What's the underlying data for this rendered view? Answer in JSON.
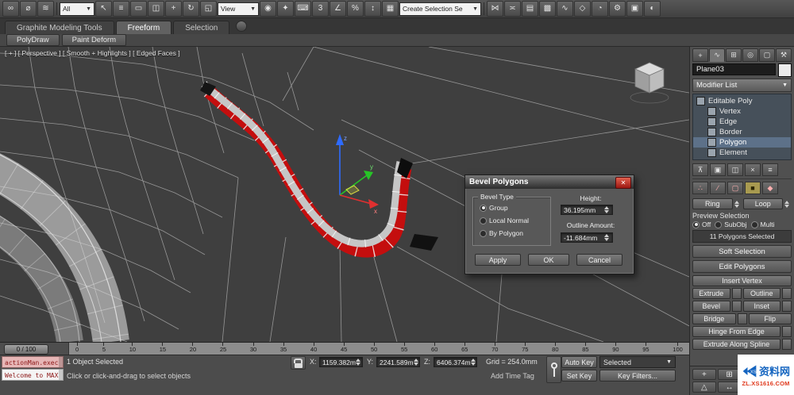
{
  "watermark": {
    "site": "资料网",
    "url": "ZL.XS1616.COM"
  },
  "toolbar": {
    "filter_value": "All",
    "coord_value": "View",
    "selection_set_value": "Create Selection Se",
    "group1": [
      {
        "name": "select-and-link-icon",
        "glyph": "∞"
      },
      {
        "name": "unlink-selection-icon",
        "glyph": "⌀"
      },
      {
        "name": "bind-to-space-warp-icon",
        "glyph": "≋"
      }
    ],
    "group2": [
      {
        "name": "select-object-icon",
        "glyph": "↖"
      },
      {
        "name": "select-by-name-icon",
        "glyph": "≡"
      },
      {
        "name": "rectangular-selection-region-icon",
        "glyph": "▭"
      },
      {
        "name": "window-crossing-icon",
        "glyph": "◫"
      },
      {
        "name": "select-and-move-icon",
        "glyph": "+"
      },
      {
        "name": "select-and-rotate-icon",
        "glyph": "↻"
      },
      {
        "name": "select-and-scale-icon",
        "glyph": "◱"
      }
    ],
    "group3": [
      {
        "name": "use-pivot-point-center-icon",
        "glyph": "◉"
      },
      {
        "name": "select-and-manipulate-icon",
        "glyph": "✦"
      },
      {
        "name": "keyboard-shortcut-override-icon",
        "glyph": "⌨"
      },
      {
        "name": "snaps-toggle-icon",
        "glyph": "3"
      },
      {
        "name": "angle-snap-icon",
        "glyph": "∠"
      },
      {
        "name": "percent-snap-icon",
        "glyph": "%"
      },
      {
        "name": "spinner-snap-icon",
        "glyph": "↕"
      },
      {
        "name": "named-selection-sets-icon",
        "glyph": "▦"
      }
    ],
    "group4": [
      {
        "name": "mirror-icon",
        "glyph": "⋈"
      },
      {
        "name": "align-icon",
        "glyph": "≍"
      },
      {
        "name": "layer-manager-icon",
        "glyph": "▤"
      },
      {
        "name": "graphite-ribbon-icon",
        "glyph": "▩"
      },
      {
        "name": "curve-editor-icon",
        "glyph": "∿"
      },
      {
        "name": "schematic-view-icon",
        "glyph": "◇"
      },
      {
        "name": "material-editor-icon",
        "glyph": "◔"
      },
      {
        "name": "render-setup-icon",
        "glyph": "⚙"
      },
      {
        "name": "rendered-frame-icon",
        "glyph": "▣"
      },
      {
        "name": "render-production-icon",
        "glyph": "◐"
      }
    ]
  },
  "ribbon": {
    "tabs": [
      {
        "label": "Graphite Modeling Tools"
      },
      {
        "label": "Freeform",
        "active": true
      },
      {
        "label": "Selection"
      }
    ],
    "subtabs": [
      {
        "label": "PolyDraw"
      },
      {
        "label": "Paint Deform"
      }
    ]
  },
  "viewport": {
    "label": "[ + ]  [ Perspective ]  [ Smooth + Highlights ]  [ Edged Faces ]"
  },
  "dialog": {
    "title": "Bevel Polygons",
    "group_label": "Bevel Type",
    "radios": [
      "Group",
      "Local Normal",
      "By Polygon"
    ],
    "height_label": "Height:",
    "height_value": "36.195mm",
    "outline_label": "Outline Amount:",
    "outline_value": "-11.684mm",
    "apply": "Apply",
    "ok": "OK",
    "cancel": "Cancel"
  },
  "panel": {
    "tabs": [
      {
        "name": "create-tab-icon",
        "glyph": "+"
      },
      {
        "name": "modify-tab-icon",
        "glyph": "∿",
        "active": true
      },
      {
        "name": "hierarchy-tab-icon",
        "glyph": "⊞"
      },
      {
        "name": "motion-tab-icon",
        "glyph": "◎"
      },
      {
        "name": "display-tab-icon",
        "glyph": "▢"
      },
      {
        "name": "utilities-tab-icon",
        "glyph": "⚒"
      }
    ],
    "object_name": "Plane03",
    "modifier_list_label": "Modifier List",
    "stack": [
      {
        "label": "Editable Poly",
        "indent": 0
      },
      {
        "label": "Vertex",
        "indent": 1
      },
      {
        "label": "Edge",
        "indent": 1
      },
      {
        "label": "Border",
        "indent": 1
      },
      {
        "label": "Polygon",
        "indent": 1,
        "active": true
      },
      {
        "label": "Element",
        "indent": 1
      }
    ],
    "stack_tools": [
      {
        "name": "pin-stack-icon",
        "glyph": "⊼"
      },
      {
        "name": "show-end-result-icon",
        "glyph": "▣"
      },
      {
        "name": "make-unique-icon",
        "glyph": "◫"
      },
      {
        "name": "remove-modifier-icon",
        "glyph": "×"
      },
      {
        "name": "configure-modifier-sets-icon",
        "glyph": "≡"
      }
    ],
    "subobj_icons": [
      {
        "name": "vertex-subobject-icon",
        "glyph": "∴"
      },
      {
        "name": "edge-subobject-icon",
        "glyph": "∕"
      },
      {
        "name": "border-subobject-icon",
        "glyph": "▢"
      },
      {
        "name": "polygon-subobject-icon",
        "glyph": "■",
        "active": true
      },
      {
        "name": "element-subobject-icon",
        "glyph": "◆"
      }
    ],
    "ring": "Ring",
    "loop": "Loop",
    "preview_label": "Preview Selection",
    "preview_options": [
      "Off",
      "SubObj",
      "Multi"
    ],
    "selection_info": "11 Polygons Selected",
    "soft_selection": "Soft Selection",
    "edit_polygons": "Edit Polygons",
    "insert_vertex": "Insert Vertex",
    "edit_rows": [
      [
        {
          "label": "Extrude",
          "sq": true
        },
        {
          "label": "Outline",
          "sq": true
        }
      ],
      [
        {
          "label": "Bevel",
          "sq": true
        },
        {
          "label": "Inset",
          "sq": true
        }
      ],
      [
        {
          "label": "Bridge",
          "sq": true
        },
        {
          "label": "Flip",
          "sq": false
        }
      ]
    ],
    "hinge": "Hinge From Edge",
    "extrude_along_spline": "Extrude Along Spline"
  },
  "timeline": {
    "slider_label": "0 / 100",
    "ticks": [
      "0",
      "5",
      "10",
      "15",
      "20",
      "25",
      "30",
      "35",
      "40",
      "45",
      "50",
      "55",
      "60",
      "65",
      "70",
      "75",
      "80",
      "85",
      "90",
      "95",
      "100"
    ]
  },
  "status": {
    "macro_text": "actionMan.exec",
    "listener_text": "Welcome to MAX",
    "selected_count": "1 Object Selected",
    "prompt": "Click or click-and-drag to select objects",
    "x_label": "X:",
    "x_value": "1159.382m",
    "y_label": "Y:",
    "y_value": "2241.589m",
    "z_label": "Z:",
    "z_value": "6406.374m",
    "grid": "Grid = 254.0mm",
    "add_time_tag": "Add Time Tag",
    "auto_key": "Auto Key",
    "set_key": "Set Key",
    "selected_mode": "Selected",
    "key_filters": "Key Filters..."
  },
  "nav": {
    "icons": [
      {
        "name": "zoom-icon",
        "glyph": "+"
      },
      {
        "name": "zoom-all-icon",
        "glyph": "⊞"
      },
      {
        "name": "zoom-extents-icon",
        "glyph": "▣"
      },
      {
        "name": "zoom-region-icon",
        "glyph": "▭"
      },
      {
        "name": "fov-icon",
        "glyph": "△"
      },
      {
        "name": "pan-icon",
        "glyph": "↔"
      },
      {
        "name": "orbit-icon",
        "glyph": "↻"
      },
      {
        "name": "maximize-viewport-icon",
        "glyph": "⊡"
      }
    ]
  }
}
